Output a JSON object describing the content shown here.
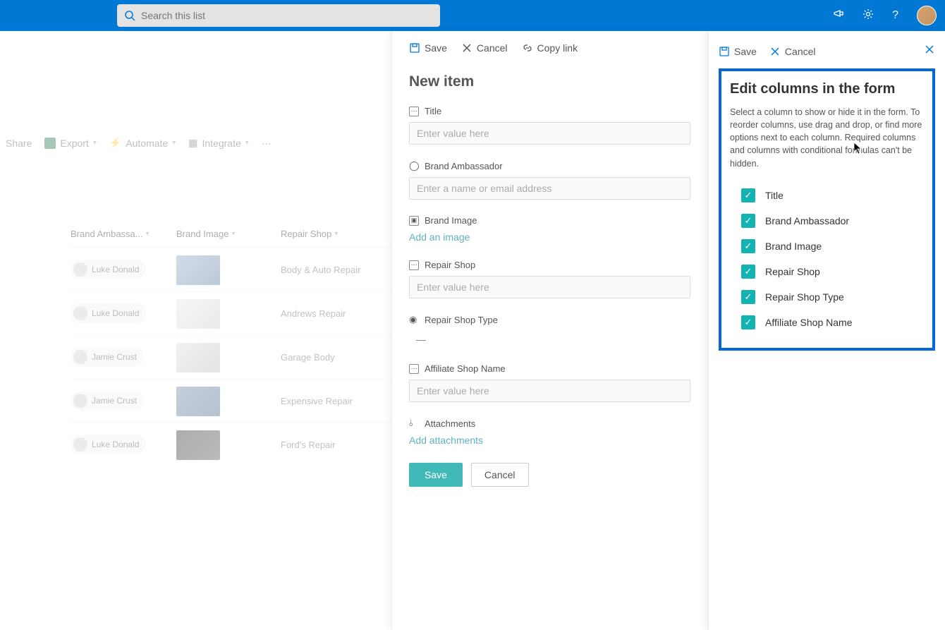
{
  "topbar": {
    "search_placeholder": "Search this list"
  },
  "commands": {
    "share": "Share",
    "export": "Export",
    "automate": "Automate",
    "integrate": "Integrate"
  },
  "list": {
    "col_ambassador": "Brand Ambassa...",
    "col_image": "Brand Image",
    "col_shop": "Repair Shop",
    "rows": [
      {
        "ambassador": "Luke Donald",
        "shop": "Body & Auto Repair"
      },
      {
        "ambassador": "Luke Donald",
        "shop": "Andrews Repair"
      },
      {
        "ambassador": "Jamie Crust",
        "shop": "Garage Body"
      },
      {
        "ambassador": "Jamie Crust",
        "shop": "Expensive Repair"
      },
      {
        "ambassador": "Luke Donald",
        "shop": "Ford's Repair"
      }
    ]
  },
  "new_item": {
    "panel_save": "Save",
    "panel_cancel": "Cancel",
    "panel_copy": "Copy link",
    "title": "New item",
    "field_title": "Title",
    "field_title_ph": "Enter value here",
    "field_ambassador": "Brand Ambassador",
    "field_ambassador_ph": "Enter a name or email address",
    "field_image": "Brand Image",
    "add_image": "Add an image",
    "field_repair": "Repair Shop",
    "field_repair_ph": "Enter value here",
    "field_repair_type": "Repair Shop Type",
    "dash": "—",
    "field_affiliate": "Affiliate Shop Name",
    "field_affiliate_ph": "Enter value here",
    "field_attachments": "Attachments",
    "add_attachments": "Add attachments",
    "btn_save": "Save",
    "btn_cancel": "Cancel"
  },
  "edit_columns": {
    "save": "Save",
    "cancel": "Cancel",
    "title": "Edit columns in the form",
    "description": "Select a column to show or hide it in the form. To reorder columns, use drag and drop, or find more options next to each column. Required columns and columns with conditional formulas can't be hidden.",
    "items": [
      "Title",
      "Brand Ambassador",
      "Brand Image",
      "Repair Shop",
      "Repair Shop Type",
      "Affiliate Shop Name"
    ]
  }
}
